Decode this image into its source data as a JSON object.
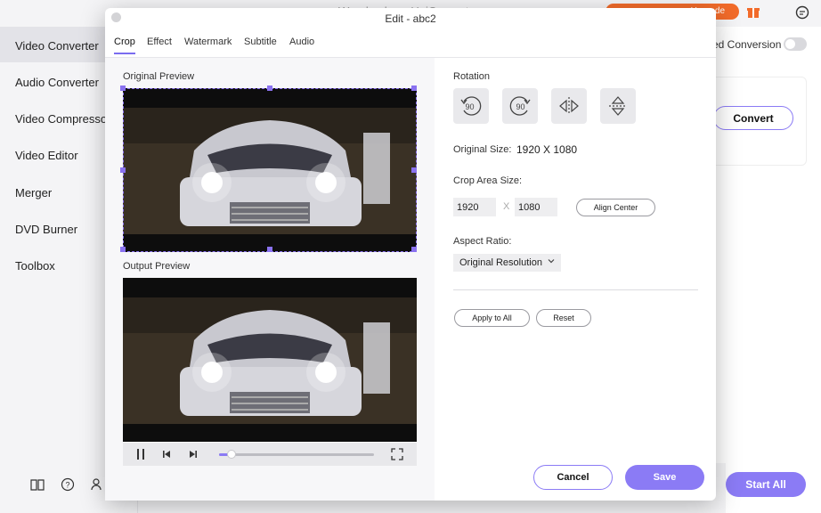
{
  "app": {
    "title": "Wondershare UniConverter",
    "promo_label": "Upgrade",
    "sidebar": {
      "items": [
        {
          "label": "Video Converter",
          "active": true
        },
        {
          "label": "Audio Converter"
        },
        {
          "label": "Video Compressor"
        },
        {
          "label": "Video Editor"
        },
        {
          "label": "Merger"
        },
        {
          "label": "DVD Burner"
        },
        {
          "label": "Toolbox"
        }
      ]
    },
    "high_speed_label": "ed Conversion",
    "convert_label": "Convert",
    "start_all_label": "Start All"
  },
  "modal": {
    "title": "Edit - abc2",
    "tabs": [
      {
        "label": "Crop",
        "active": true
      },
      {
        "label": "Effect"
      },
      {
        "label": "Watermark"
      },
      {
        "label": "Subtitle"
      },
      {
        "label": "Audio"
      }
    ],
    "original_preview_label": "Original Preview",
    "output_preview_label": "Output Preview",
    "rotation_label": "Rotation",
    "rotation_buttons": [
      {
        "icon": "rotate-left-90-icon",
        "text": "90"
      },
      {
        "icon": "rotate-right-90-icon",
        "text": "90"
      },
      {
        "icon": "flip-horizontal-icon"
      },
      {
        "icon": "flip-vertical-icon"
      }
    ],
    "original_size_label": "Original Size:",
    "original_size_value": "1920 X 1080",
    "crop_area_label": "Crop Area Size:",
    "crop_width": "1920",
    "crop_sep": "X",
    "crop_height": "1080",
    "align_center_label": "Align Center",
    "aspect_ratio_label": "Aspect Ratio:",
    "aspect_ratio_value": "Original Resolution",
    "apply_to_all_label": "Apply to All",
    "reset_label": "Reset",
    "cancel_label": "Cancel",
    "save_label": "Save",
    "playback_progress": 0.08,
    "colors": {
      "accent": "#8b7bf5",
      "promo": "#f26b2a"
    }
  }
}
